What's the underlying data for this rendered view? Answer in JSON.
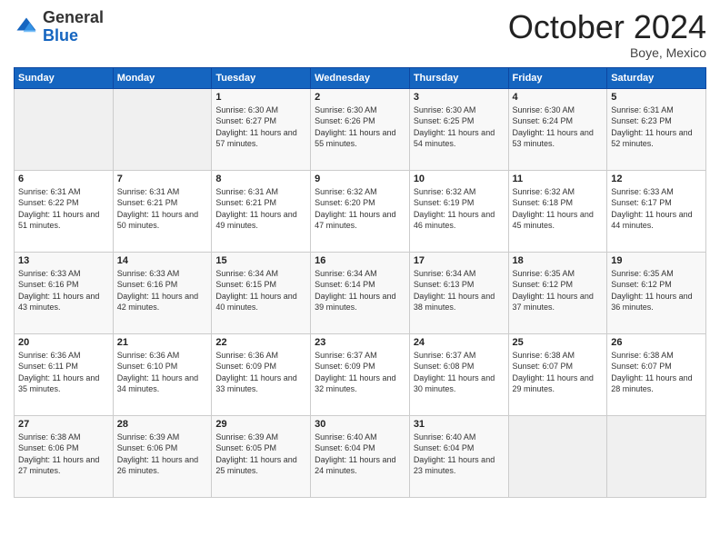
{
  "logo": {
    "general": "General",
    "blue": "Blue"
  },
  "header": {
    "month": "October 2024",
    "location": "Boye, Mexico"
  },
  "days_of_week": [
    "Sunday",
    "Monday",
    "Tuesday",
    "Wednesday",
    "Thursday",
    "Friday",
    "Saturday"
  ],
  "weeks": [
    [
      {
        "day": "",
        "sunrise": "",
        "sunset": "",
        "daylight": ""
      },
      {
        "day": "",
        "sunrise": "",
        "sunset": "",
        "daylight": ""
      },
      {
        "day": "1",
        "sunrise": "Sunrise: 6:30 AM",
        "sunset": "Sunset: 6:27 PM",
        "daylight": "Daylight: 11 hours and 57 minutes."
      },
      {
        "day": "2",
        "sunrise": "Sunrise: 6:30 AM",
        "sunset": "Sunset: 6:26 PM",
        "daylight": "Daylight: 11 hours and 55 minutes."
      },
      {
        "day": "3",
        "sunrise": "Sunrise: 6:30 AM",
        "sunset": "Sunset: 6:25 PM",
        "daylight": "Daylight: 11 hours and 54 minutes."
      },
      {
        "day": "4",
        "sunrise": "Sunrise: 6:30 AM",
        "sunset": "Sunset: 6:24 PM",
        "daylight": "Daylight: 11 hours and 53 minutes."
      },
      {
        "day": "5",
        "sunrise": "Sunrise: 6:31 AM",
        "sunset": "Sunset: 6:23 PM",
        "daylight": "Daylight: 11 hours and 52 minutes."
      }
    ],
    [
      {
        "day": "6",
        "sunrise": "Sunrise: 6:31 AM",
        "sunset": "Sunset: 6:22 PM",
        "daylight": "Daylight: 11 hours and 51 minutes."
      },
      {
        "day": "7",
        "sunrise": "Sunrise: 6:31 AM",
        "sunset": "Sunset: 6:21 PM",
        "daylight": "Daylight: 11 hours and 50 minutes."
      },
      {
        "day": "8",
        "sunrise": "Sunrise: 6:31 AM",
        "sunset": "Sunset: 6:21 PM",
        "daylight": "Daylight: 11 hours and 49 minutes."
      },
      {
        "day": "9",
        "sunrise": "Sunrise: 6:32 AM",
        "sunset": "Sunset: 6:20 PM",
        "daylight": "Daylight: 11 hours and 47 minutes."
      },
      {
        "day": "10",
        "sunrise": "Sunrise: 6:32 AM",
        "sunset": "Sunset: 6:19 PM",
        "daylight": "Daylight: 11 hours and 46 minutes."
      },
      {
        "day": "11",
        "sunrise": "Sunrise: 6:32 AM",
        "sunset": "Sunset: 6:18 PM",
        "daylight": "Daylight: 11 hours and 45 minutes."
      },
      {
        "day": "12",
        "sunrise": "Sunrise: 6:33 AM",
        "sunset": "Sunset: 6:17 PM",
        "daylight": "Daylight: 11 hours and 44 minutes."
      }
    ],
    [
      {
        "day": "13",
        "sunrise": "Sunrise: 6:33 AM",
        "sunset": "Sunset: 6:16 PM",
        "daylight": "Daylight: 11 hours and 43 minutes."
      },
      {
        "day": "14",
        "sunrise": "Sunrise: 6:33 AM",
        "sunset": "Sunset: 6:16 PM",
        "daylight": "Daylight: 11 hours and 42 minutes."
      },
      {
        "day": "15",
        "sunrise": "Sunrise: 6:34 AM",
        "sunset": "Sunset: 6:15 PM",
        "daylight": "Daylight: 11 hours and 40 minutes."
      },
      {
        "day": "16",
        "sunrise": "Sunrise: 6:34 AM",
        "sunset": "Sunset: 6:14 PM",
        "daylight": "Daylight: 11 hours and 39 minutes."
      },
      {
        "day": "17",
        "sunrise": "Sunrise: 6:34 AM",
        "sunset": "Sunset: 6:13 PM",
        "daylight": "Daylight: 11 hours and 38 minutes."
      },
      {
        "day": "18",
        "sunrise": "Sunrise: 6:35 AM",
        "sunset": "Sunset: 6:12 PM",
        "daylight": "Daylight: 11 hours and 37 minutes."
      },
      {
        "day": "19",
        "sunrise": "Sunrise: 6:35 AM",
        "sunset": "Sunset: 6:12 PM",
        "daylight": "Daylight: 11 hours and 36 minutes."
      }
    ],
    [
      {
        "day": "20",
        "sunrise": "Sunrise: 6:36 AM",
        "sunset": "Sunset: 6:11 PM",
        "daylight": "Daylight: 11 hours and 35 minutes."
      },
      {
        "day": "21",
        "sunrise": "Sunrise: 6:36 AM",
        "sunset": "Sunset: 6:10 PM",
        "daylight": "Daylight: 11 hours and 34 minutes."
      },
      {
        "day": "22",
        "sunrise": "Sunrise: 6:36 AM",
        "sunset": "Sunset: 6:09 PM",
        "daylight": "Daylight: 11 hours and 33 minutes."
      },
      {
        "day": "23",
        "sunrise": "Sunrise: 6:37 AM",
        "sunset": "Sunset: 6:09 PM",
        "daylight": "Daylight: 11 hours and 32 minutes."
      },
      {
        "day": "24",
        "sunrise": "Sunrise: 6:37 AM",
        "sunset": "Sunset: 6:08 PM",
        "daylight": "Daylight: 11 hours and 30 minutes."
      },
      {
        "day": "25",
        "sunrise": "Sunrise: 6:38 AM",
        "sunset": "Sunset: 6:07 PM",
        "daylight": "Daylight: 11 hours and 29 minutes."
      },
      {
        "day": "26",
        "sunrise": "Sunrise: 6:38 AM",
        "sunset": "Sunset: 6:07 PM",
        "daylight": "Daylight: 11 hours and 28 minutes."
      }
    ],
    [
      {
        "day": "27",
        "sunrise": "Sunrise: 6:38 AM",
        "sunset": "Sunset: 6:06 PM",
        "daylight": "Daylight: 11 hours and 27 minutes."
      },
      {
        "day": "28",
        "sunrise": "Sunrise: 6:39 AM",
        "sunset": "Sunset: 6:06 PM",
        "daylight": "Daylight: 11 hours and 26 minutes."
      },
      {
        "day": "29",
        "sunrise": "Sunrise: 6:39 AM",
        "sunset": "Sunset: 6:05 PM",
        "daylight": "Daylight: 11 hours and 25 minutes."
      },
      {
        "day": "30",
        "sunrise": "Sunrise: 6:40 AM",
        "sunset": "Sunset: 6:04 PM",
        "daylight": "Daylight: 11 hours and 24 minutes."
      },
      {
        "day": "31",
        "sunrise": "Sunrise: 6:40 AM",
        "sunset": "Sunset: 6:04 PM",
        "daylight": "Daylight: 11 hours and 23 minutes."
      },
      {
        "day": "",
        "sunrise": "",
        "sunset": "",
        "daylight": ""
      },
      {
        "day": "",
        "sunrise": "",
        "sunset": "",
        "daylight": ""
      }
    ]
  ]
}
